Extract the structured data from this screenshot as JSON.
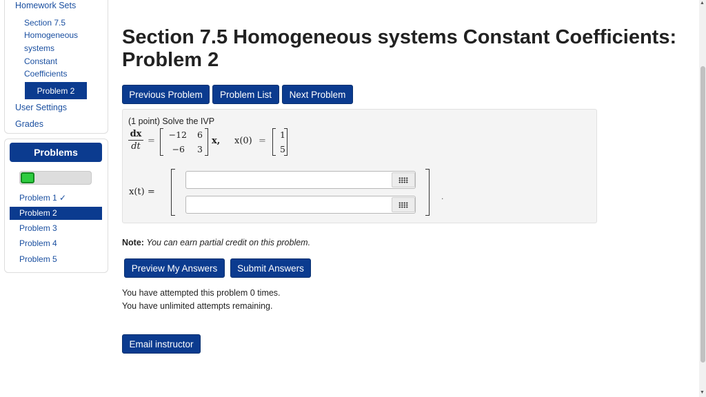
{
  "sidebar": {
    "homework_sets": "Homework Sets",
    "section_lines": [
      "Section 7.5",
      "Homogeneous",
      "systems",
      "Constant",
      "Coefficients"
    ],
    "current_problem": "Problem 2",
    "user_settings": "User Settings",
    "grades": "Grades"
  },
  "problems_panel": {
    "header": "Problems",
    "progress_fraction": 0.2,
    "items": [
      {
        "label": "Problem 1 ✓"
      },
      {
        "label": "Problem 2"
      },
      {
        "label": "Problem 3"
      },
      {
        "label": "Problem 4"
      },
      {
        "label": "Problem 5"
      }
    ]
  },
  "page": {
    "title": "Section 7.5 Homogeneous systems Constant Coefficients: Problem 2"
  },
  "nav_buttons": {
    "previous": "Previous Problem",
    "list": "Problem List",
    "next": "Next Problem"
  },
  "problem": {
    "intro": "(1 point) Solve the IVP",
    "deriv_num": "dx",
    "deriv_den": "dt",
    "equals": "=",
    "matrix": [
      "−12",
      "6",
      "−6",
      "3"
    ],
    "vector_var": "x,",
    "initial_label": "x(0)",
    "initial_vector": [
      "1",
      "5"
    ],
    "answer_label": "x(t) =",
    "answer_values": [
      "",
      ""
    ],
    "trailing": "."
  },
  "note": {
    "label": "Note:",
    "text": "You can earn partial credit on this problem."
  },
  "actions": {
    "preview": "Preview My Answers",
    "submit": "Submit Answers",
    "email": "Email instructor"
  },
  "attempts": {
    "line1": "You have attempted this problem 0 times.",
    "line2": "You have unlimited attempts remaining."
  },
  "colors": {
    "primary": "#0b3b8f",
    "link": "#1a4fa0",
    "progress_green": "#2ecc40"
  }
}
